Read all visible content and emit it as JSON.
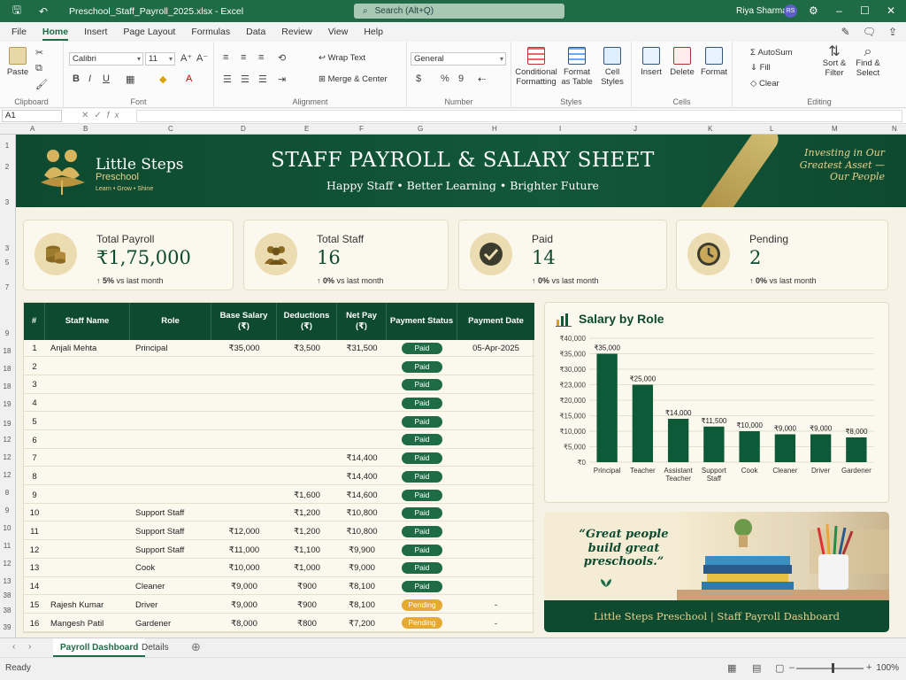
{
  "window": {
    "filename": "Preschool_Staff_Payroll_2025.xlsx",
    "app": "Excel",
    "search_placeholder": "Search (Alt+Q)",
    "user_name": "Riya Sharma",
    "user_initials": "RS"
  },
  "menu": [
    "File",
    "Home",
    "Insert",
    "Page Layout",
    "Formulas",
    "Data",
    "Review",
    "View",
    "Help"
  ],
  "ribbon": {
    "clipboard": {
      "paste": "Paste",
      "label": "Clipboard"
    },
    "font": {
      "name": "Calibri",
      "size": "11",
      "label": "Font"
    },
    "alignment": {
      "wrap": "Wrap Text",
      "merge": "Merge & Center",
      "label": "Alignment"
    },
    "number": {
      "format": "General",
      "label": "Number"
    },
    "styles": {
      "conditional": "Conditional Formatting",
      "format_table": "Format as Table",
      "cell_styles": "Cell Styles",
      "label": "Styles"
    },
    "cells": {
      "insert": "Insert",
      "delete": "Delete",
      "format": "Format",
      "label": "Cells"
    },
    "editing": {
      "autosum": "AutoSum",
      "fill": "Fill",
      "clear": "Clear",
      "sort": "Sort & Filter",
      "find": "Find & Select",
      "label": "Editing"
    }
  },
  "formula_bar": {
    "name_box": "A1",
    "fx": "fx"
  },
  "columns": [
    "A",
    "B",
    "C",
    "D",
    "E",
    "F",
    "G",
    "H",
    "I",
    "J",
    "K",
    "L",
    "M",
    "N"
  ],
  "banner": {
    "school_name": "Little Steps",
    "school_type": "Preschool",
    "tagline": "Learn • Grow • Shine",
    "title": "STAFF PAYROLL & SALARY SHEET",
    "subtitle": "Happy Staff  •  Better Learning  •  Brighter Future",
    "motto": "Investing in Our Greatest Asset — Our People"
  },
  "kpis": [
    {
      "label": "Total Payroll",
      "value": "₹1,75,000",
      "trend_pct": "5%",
      "trend_text": "vs last month",
      "icon": "coins-icon"
    },
    {
      "label": "Total Staff",
      "value": "16",
      "trend_pct": "0%",
      "trend_text": "vs last month",
      "icon": "people-icon"
    },
    {
      "label": "Paid",
      "value": "14",
      "trend_pct": "0%",
      "trend_text": "vs last month",
      "icon": "check-icon"
    },
    {
      "label": "Pending",
      "value": "2",
      "trend_pct": "0%",
      "trend_text": "vs last month",
      "icon": "clock-icon"
    }
  ],
  "table": {
    "headers": [
      "#",
      "Staff Name",
      "Role",
      "Base Salary (₹)",
      "Deductions (₹)",
      "Net Pay (₹)",
      "Payment Status",
      "Payment Date"
    ],
    "rows": [
      {
        "n": "1",
        "name": "Anjali Mehta",
        "role": "Principal",
        "base": "₹35,000",
        "ded": "₹3,500",
        "net": "₹31,500",
        "status": "Paid",
        "date": "05-Apr-2025"
      },
      {
        "n": "2",
        "name": "",
        "role": "",
        "base": "",
        "ded": "",
        "net": "",
        "status": "Paid",
        "date": ""
      },
      {
        "n": "3",
        "name": "",
        "role": "",
        "base": "",
        "ded": "",
        "net": "",
        "status": "Paid",
        "date": ""
      },
      {
        "n": "4",
        "name": "",
        "role": "",
        "base": "",
        "ded": "",
        "net": "",
        "status": "Paid",
        "date": ""
      },
      {
        "n": "5",
        "name": "",
        "role": "",
        "base": "",
        "ded": "",
        "net": "",
        "status": "Paid",
        "date": ""
      },
      {
        "n": "6",
        "name": "",
        "role": "",
        "base": "",
        "ded": "",
        "net": "",
        "status": "Paid",
        "date": ""
      },
      {
        "n": "7",
        "name": "",
        "role": "",
        "base": "",
        "ded": "",
        "net": "₹14,400",
        "status": "Paid",
        "date": ""
      },
      {
        "n": "8",
        "name": "",
        "role": "",
        "base": "",
        "ded": "",
        "net": "₹14,400",
        "status": "Paid",
        "date": ""
      },
      {
        "n": "9",
        "name": "",
        "role": "",
        "base": "",
        "ded": "₹1,600",
        "net": "₹14,600",
        "status": "Paid",
        "date": ""
      },
      {
        "n": "10",
        "name": "",
        "role": "Support Staff",
        "base": "",
        "ded": "₹1,200",
        "net": "₹10,800",
        "status": "Paid",
        "date": ""
      },
      {
        "n": "11",
        "name": "",
        "role": "Support Staff",
        "base": "₹12,000",
        "ded": "₹1,200",
        "net": "₹10,800",
        "status": "Paid",
        "date": ""
      },
      {
        "n": "12",
        "name": "",
        "role": "Support Staff",
        "base": "₹11,000",
        "ded": "₹1,100",
        "net": "₹9,900",
        "status": "Paid",
        "date": ""
      },
      {
        "n": "13",
        "name": "",
        "role": "Cook",
        "base": "₹10,000",
        "ded": "₹1,000",
        "net": "₹9,000",
        "status": "Paid",
        "date": ""
      },
      {
        "n": "14",
        "name": "",
        "role": "Cleaner",
        "base": "₹9,000",
        "ded": "₹900",
        "net": "₹8,100",
        "status": "Paid",
        "date": ""
      },
      {
        "n": "15",
        "name": "Rajesh Kumar",
        "role": "Driver",
        "base": "₹9,000",
        "ded": "₹900",
        "net": "₹8,100",
        "status": "Pending",
        "date": "-"
      },
      {
        "n": "16",
        "name": "Mangesh Patil",
        "role": "Gardener",
        "base": "₹8,000",
        "ded": "₹800",
        "net": "₹7,200",
        "status": "Pending",
        "date": "-"
      }
    ]
  },
  "chart_data": {
    "type": "bar",
    "title": "Salary by Role",
    "categories": [
      "Principal",
      "Teacher",
      "Assistant Teacher",
      "Support Staff",
      "Cook",
      "Cleaner",
      "Driver",
      "Gardener"
    ],
    "values": [
      35000,
      25000,
      14000,
      11500,
      10000,
      9000,
      9000,
      8000
    ],
    "value_labels": [
      "₹35,000",
      "₹25,000",
      "₹14,000",
      "₹11,500",
      "₹10,000",
      "₹9,000",
      "₹9,000",
      "₹8,000"
    ],
    "yticks": [
      "₹0",
      "₹5,000",
      "₹10,000",
      "₹15,000",
      "₹20,000",
      "₹23,000",
      "₹30,000",
      "₹35,000",
      "₹40,000"
    ],
    "ylim": [
      0,
      40000
    ],
    "grid": true,
    "color": "#0e5a38"
  },
  "quote": {
    "text": "“Great people build great preschools.”",
    "footer": "Little Steps Preschool  |  Staff Payroll Dashboard"
  },
  "sheet_tabs": [
    "Payroll Dashboard",
    "Details"
  ],
  "status": {
    "ready": "Ready",
    "zoom": "100%"
  },
  "colors": {
    "brand_green": "#0e4a30",
    "gold": "#e8d08a",
    "pending": "#e6a933"
  }
}
